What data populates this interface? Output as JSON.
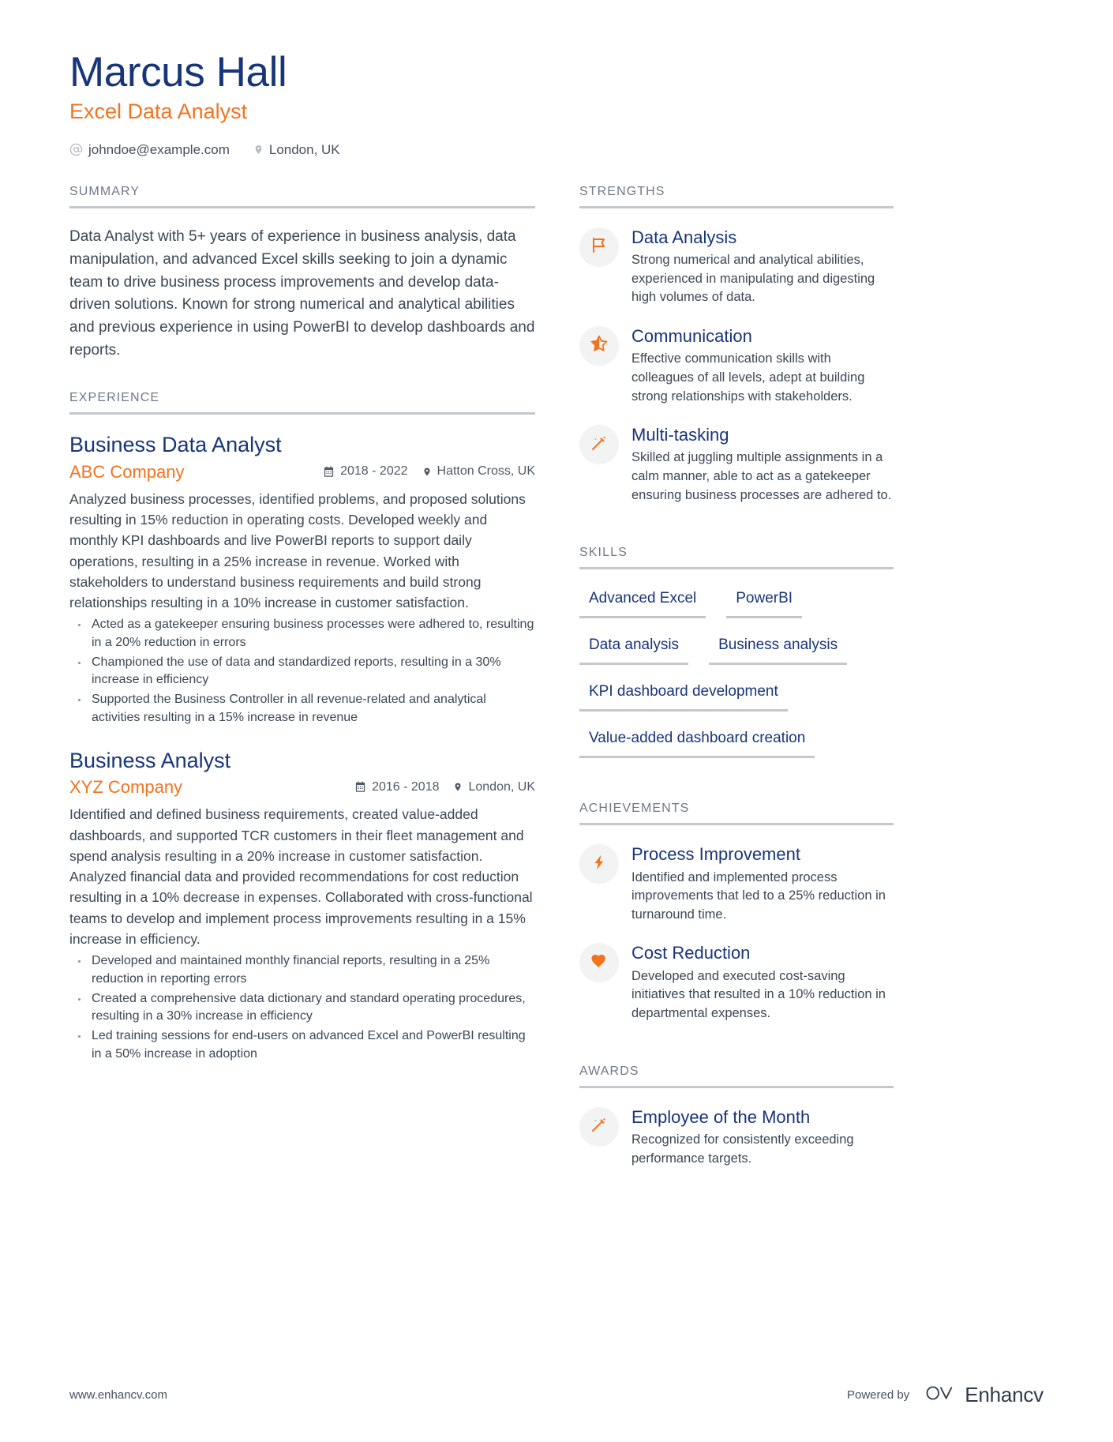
{
  "header": {
    "full_name": "Marcus Hall",
    "job_title": "Excel Data Analyst",
    "email": "johndoe@example.com",
    "location": "London, UK",
    "email_icon": "at-sign-icon",
    "location_icon": "map-pin-icon"
  },
  "colors": {
    "navy": "#17357a",
    "orange": "#f4721e",
    "body_text": "#3b4754",
    "section_label": "#6f7a86",
    "rule": "#c4c8cc",
    "icon_circle_bg": "#f2f3f3"
  },
  "sections": {
    "summary_label": "SUMMARY",
    "experience_label": "EXPERIENCE",
    "strengths_label": "STRENGTHS",
    "skills_label": "SKILLS",
    "achievements_label": "ACHIEVEMENTS",
    "awards_label": "AWARDS"
  },
  "summary": {
    "text": "Data Analyst with 5+ years of experience in business analysis, data manipulation, and advanced Excel skills seeking to join a dynamic team to drive business process improvements and develop data-driven solutions. Known for strong numerical and analytical abilities and previous experience in using PowerBI to develop dashboards and reports."
  },
  "experience": [
    {
      "role": "Business Data Analyst",
      "company": "ABC Company",
      "dates": "2018 - 2022",
      "location": "Hatton Cross, UK",
      "description": "Analyzed business processes, identified problems, and proposed solutions resulting in 15% reduction in operating costs. Developed weekly and monthly KPI dashboards and live PowerBI reports to support daily operations, resulting in a 25% increase in revenue. Worked with stakeholders to understand business requirements and build strong relationships resulting in a 10% increase in customer satisfaction.",
      "bullets": [
        "Acted as a gatekeeper ensuring business processes were adhered to, resulting in a 20% reduction in errors",
        "Championed the use of data and standardized reports, resulting in a 30% increase in efficiency",
        "Supported the Business Controller in all revenue-related and analytical activities resulting in a 15% increase in revenue"
      ]
    },
    {
      "role": "Business Analyst",
      "company": "XYZ Company",
      "dates": "2016 - 2018",
      "location": "London, UK",
      "description": "Identified and defined business requirements, created value-added dashboards, and supported TCR customers in their fleet management and spend analysis resulting in a 20% increase in customer satisfaction. Analyzed financial data and provided recommendations for cost reduction resulting in a 10% decrease in expenses. Collaborated with cross-functional teams to develop and implement process improvements resulting in a 15% increase in efficiency.",
      "bullets": [
        "Developed and maintained monthly financial reports, resulting in a 25% reduction in reporting errors",
        "Created a comprehensive data dictionary and standard operating procedures, resulting in a 30% increase in efficiency",
        "Led training sessions for end-users on advanced Excel and PowerBI resulting in a 50% increase in adoption"
      ]
    }
  ],
  "strengths": [
    {
      "icon": "flag-icon",
      "title": "Data Analysis",
      "description": "Strong numerical and analytical abilities, experienced in manipulating and digesting high volumes of data."
    },
    {
      "icon": "star-icon",
      "title": "Communication",
      "description": "Effective communication skills with colleagues of all levels, adept at building strong relationships with stakeholders."
    },
    {
      "icon": "magic-wand-icon",
      "title": "Multi-tasking",
      "description": "Skilled at juggling multiple assignments in a calm manner, able to act as a gatekeeper ensuring business processes are adhered to."
    }
  ],
  "skills": [
    "Advanced Excel",
    "PowerBI",
    "Data analysis",
    "Business analysis",
    "KPI dashboard development",
    "Value-added dashboard creation"
  ],
  "achievements": [
    {
      "icon": "lightning-bolt-icon",
      "title": "Process Improvement",
      "description": "Identified and implemented process improvements that led to a 25% reduction in turnaround time."
    },
    {
      "icon": "heart-icon",
      "title": "Cost Reduction",
      "description": "Developed and executed cost-saving initiatives that resulted in a 10% reduction in departmental expenses."
    }
  ],
  "awards": [
    {
      "icon": "magic-wand-icon",
      "title": "Employee of the Month",
      "description": "Recognized for consistently exceeding performance targets."
    }
  ],
  "footer": {
    "url": "www.enhancv.com",
    "powered_by": "Powered by",
    "brand": "Enhancv"
  }
}
